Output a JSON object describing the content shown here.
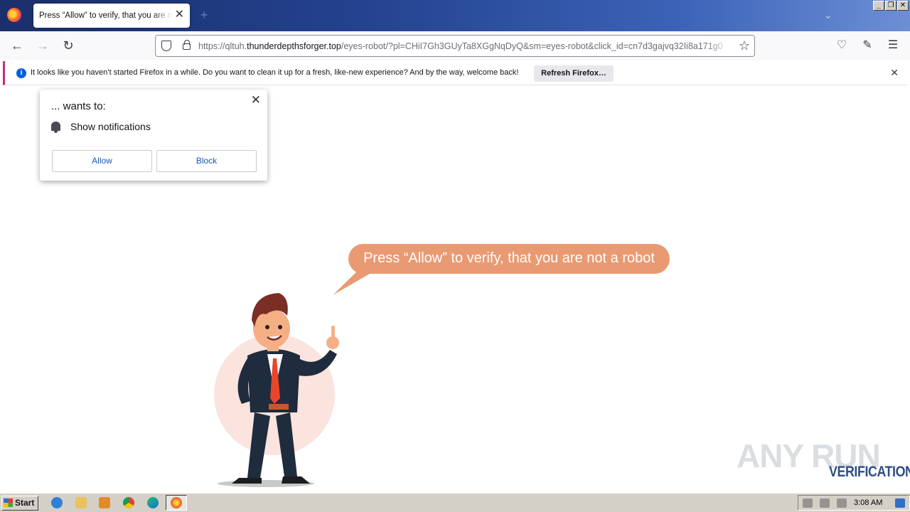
{
  "tab": {
    "title": "Press “Allow” to verify, that you are not a robot",
    "close": "✕",
    "new_tab": "+"
  },
  "window_controls": {
    "minimize": "_",
    "restore": "❐",
    "close": "✕"
  },
  "nav": {
    "url_prefix": "https://qltuh.",
    "url_domain": "thunderdepthsforger.top",
    "url_path": "/eyes-robot/?pl=CHiI7Gh3GUyTa8XGgNqDyQ&sm=eyes-robot&click_id=cn7d3gajvq32Ii8a171g0"
  },
  "infobar": {
    "message": "It looks like you haven’t started Firefox in a while. Do you want to clean it up for a fresh, like-new experience? And by the way, welcome back!",
    "button": "Refresh Firefox…",
    "close": "✕"
  },
  "popup": {
    "title": "... wants to:",
    "permission": "Show notifications",
    "allow": "Allow",
    "block": "Block",
    "close": "✕"
  },
  "page": {
    "bubble_text": "Press “Allow” to verify, that you are not a robot",
    "bubble_color": "#e99a72"
  },
  "watermark": {
    "brand": "ANY RUN",
    "label": "VERIFICATION"
  },
  "taskbar": {
    "start": "Start",
    "clock": "3:08 AM"
  },
  "icons": {
    "back": "back-arrow-icon",
    "forward": "forward-arrow-icon",
    "reload": "reload-icon",
    "pocket": "pocket-icon",
    "extensions": "extensions-icon",
    "menu": "hamburger-menu-icon"
  }
}
